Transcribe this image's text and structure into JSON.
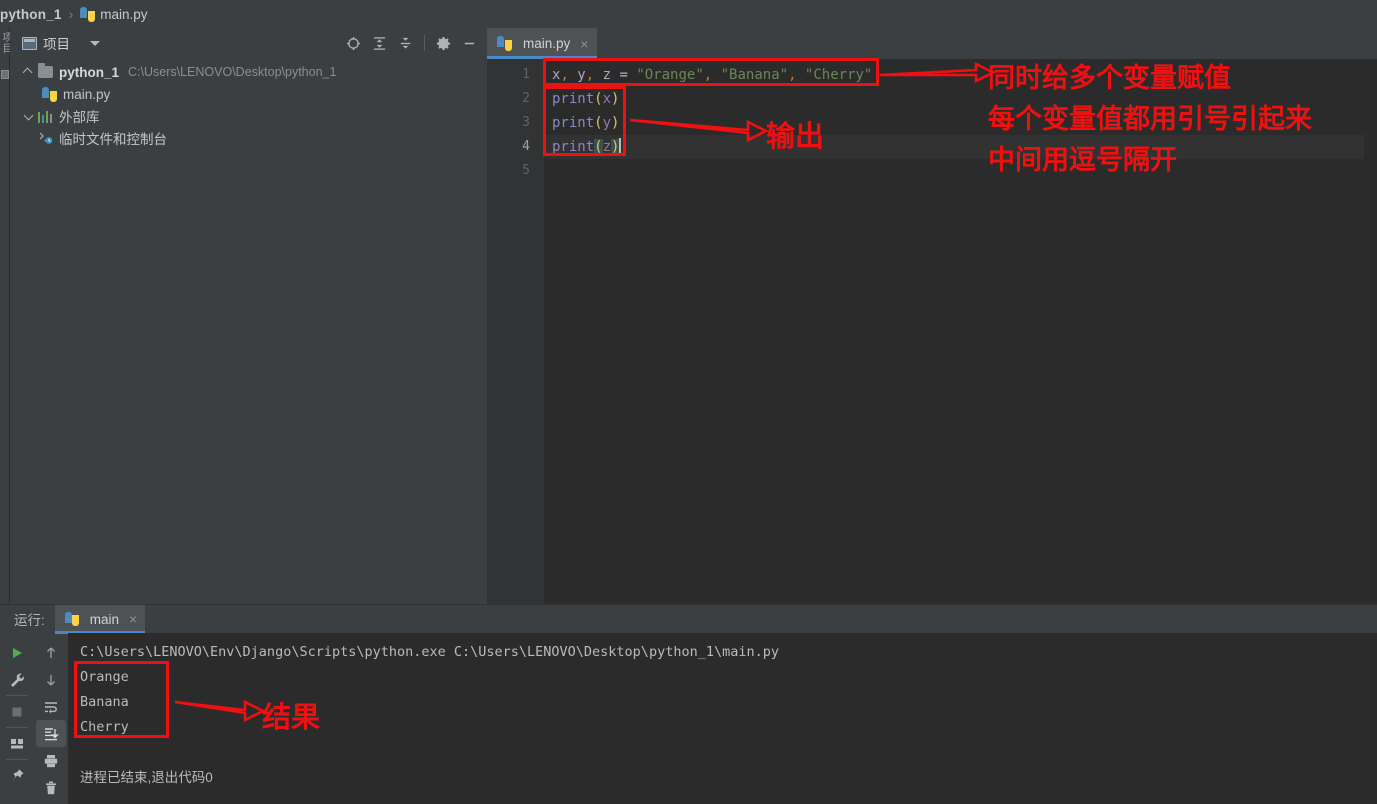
{
  "breadcrumb": {
    "project": "python_1",
    "separator": "›",
    "file": "main.py"
  },
  "left_stripe": {
    "label": "项目"
  },
  "project_panel": {
    "title": "项目",
    "tools": [
      "locate-icon",
      "expand-all-icon",
      "collapse-all-icon",
      "settings-icon",
      "minimize-icon"
    ],
    "tree": [
      {
        "label": "python_1",
        "path": "C:\\Users\\LENOVO\\Desktop\\python_1",
        "icon": "folder-icon",
        "expanded": true,
        "bold": true,
        "indent": 0
      },
      {
        "label": "main.py",
        "path": "",
        "icon": "python-file-icon",
        "expanded": null,
        "bold": false,
        "indent": 1
      },
      {
        "label": "外部库",
        "path": "",
        "icon": "library-icon",
        "expanded": false,
        "bold": false,
        "indent": 0
      },
      {
        "label": "临时文件和控制台",
        "path": "",
        "icon": "scratches-icon",
        "expanded": null,
        "bold": false,
        "indent": 0
      }
    ]
  },
  "editor": {
    "tab": {
      "label": "main.py",
      "close": "×",
      "icon": "python-file-icon"
    },
    "line_numbers": [
      "1",
      "2",
      "3",
      "4",
      "5"
    ],
    "current_line": 4,
    "code": {
      "line1": {
        "v1": "x",
        "c1": ",",
        "v2": " y",
        "c2": ",",
        "v3": " z",
        "eq": " = ",
        "s1": "\"Orange\"",
        "c3": ",",
        "s2": " \"Banana\"",
        "c4": ",",
        "s3": " \"Cherry\""
      },
      "line2": {
        "fn": "print",
        "open": "(",
        "arg": "x",
        "close": ")"
      },
      "line3": {
        "fn": "print",
        "open": "(",
        "arg": "y",
        "close": ")"
      },
      "line4": {
        "fn": "print",
        "open": "(",
        "arg": "z",
        "close": ")"
      },
      "line5": ""
    }
  },
  "run_panel": {
    "label": "运行:",
    "tab": {
      "label": "main",
      "close": "×",
      "icon": "python-icon"
    },
    "toolbar_left": [
      "run-icon",
      "wrench-icon",
      "stop-icon",
      "layout-icon",
      "pin-icon"
    ],
    "toolbar_right": [
      "scroll-up-icon",
      "scroll-down-icon",
      "soft-wrap-icon",
      "scroll-to-end-icon",
      "print-icon",
      "trash-icon"
    ],
    "console": {
      "command": "C:\\Users\\LENOVO\\Env\\Django\\Scripts\\python.exe C:\\Users\\LENOVO\\Desktop\\python_1\\main.py",
      "output": [
        "Orange",
        "Banana",
        "Cherry"
      ],
      "exit_message": "进程已结束,退出代码0"
    }
  },
  "annotations": {
    "note1": "同时给多个变量赋值",
    "note2": "每个变量值都用引号引起来",
    "note3": "中间用逗号隔开",
    "note_output": "输出",
    "note_result": "结果",
    "color": "#ee1111"
  }
}
